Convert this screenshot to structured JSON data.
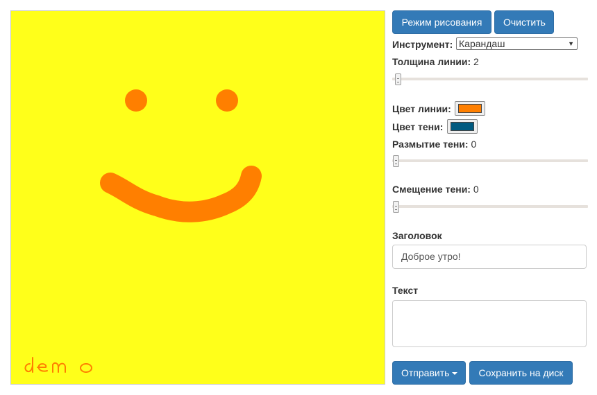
{
  "canvas": {
    "background": "#ffff1a",
    "smiley_color": "#ff7f00",
    "signature_color": "#ff7f00",
    "signature_text": "demo"
  },
  "toolbar": {
    "draw_mode_label": "Режим рисования",
    "clear_label": "Очистить"
  },
  "tool": {
    "label": "Инструмент:",
    "selected": "Карандаш"
  },
  "line_width": {
    "label": "Толщина линии:",
    "value": "2"
  },
  "line_color": {
    "label": "Цвет линии:",
    "color": "#ff7f00"
  },
  "shadow_color": {
    "label": "Цвет тени:",
    "color": "#005a80"
  },
  "shadow_blur": {
    "label": "Размытие тени:",
    "value": "0"
  },
  "shadow_offset": {
    "label": "Смещение тени:",
    "value": "0"
  },
  "title_field": {
    "label": "Заголовок",
    "value": "Доброе утро!"
  },
  "text_field": {
    "label": "Текст",
    "value": ""
  },
  "actions": {
    "send_label": "Отправить",
    "save_label": "Сохранить на диск"
  }
}
